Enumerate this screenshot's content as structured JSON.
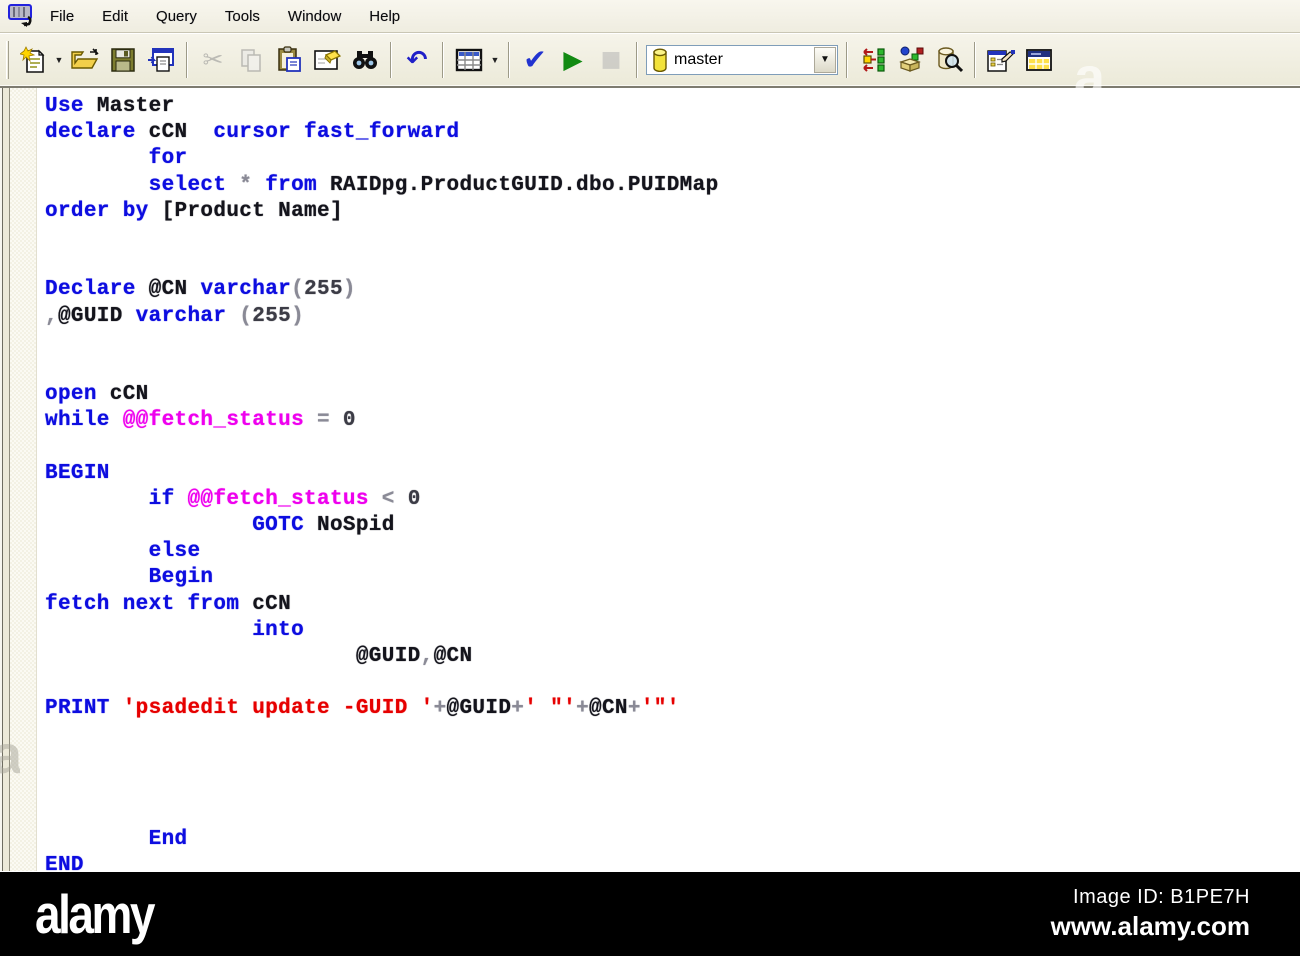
{
  "menubar": {
    "items": [
      "File",
      "Edit",
      "Query",
      "Tools",
      "Window",
      "Help"
    ]
  },
  "toolbar": {
    "icons": [
      "new-query-icon",
      "open-icon",
      "save-icon",
      "insert-template-icon",
      "cut-icon",
      "copy-icon",
      "paste-icon",
      "clear-window-icon",
      "find-icon",
      "undo-icon",
      "execute-mode-grid-icon",
      "parse-query-icon",
      "execute-query-icon",
      "cancel-query-icon",
      "database-cylinder-icon",
      "execution-plan-icon",
      "object-browser-icon",
      "object-search-icon",
      "connection-properties-icon",
      "results-pane-icon"
    ],
    "database_combo": {
      "value": "master"
    },
    "glyphs": {
      "cut": "✂",
      "undo": "↶",
      "parse": "✔",
      "execute": "▶",
      "stop": "■",
      "caret": "▼"
    }
  },
  "editor": {
    "language": "sql",
    "lines": [
      [
        [
          "kw",
          "Use "
        ],
        [
          "id",
          "Master"
        ]
      ],
      [
        [
          "kw",
          "declare "
        ],
        [
          "id",
          "cCN  "
        ],
        [
          "kw",
          "cursor fast_forward"
        ]
      ],
      [
        [
          "id",
          "        "
        ],
        [
          "kw",
          "for"
        ]
      ],
      [
        [
          "id",
          "        "
        ],
        [
          "kw",
          "select "
        ],
        [
          "op",
          "* "
        ],
        [
          "kw",
          "from "
        ],
        [
          "id",
          "RAIDpg.ProductGUID.dbo.PUIDMap"
        ]
      ],
      [
        [
          "kw",
          "order by "
        ],
        [
          "id",
          "[Product Name]"
        ]
      ],
      [],
      [],
      [
        [
          "kw",
          "Declare "
        ],
        [
          "id",
          "@CN "
        ],
        [
          "kw",
          "varchar"
        ],
        [
          "op",
          "("
        ],
        [
          "num",
          "255"
        ],
        [
          "op",
          ")"
        ]
      ],
      [
        [
          "op",
          ","
        ],
        [
          "id",
          "@GUID "
        ],
        [
          "kw",
          "varchar "
        ],
        [
          "op",
          "("
        ],
        [
          "num",
          "255"
        ],
        [
          "op",
          ")"
        ]
      ],
      [],
      [],
      [
        [
          "kw",
          "open "
        ],
        [
          "id",
          "cCN"
        ]
      ],
      [
        [
          "kw",
          "while "
        ],
        [
          "sys",
          "@@fetch_status"
        ],
        [
          "op",
          " = "
        ],
        [
          "num",
          "0"
        ]
      ],
      [],
      [
        [
          "kw",
          "BEGIN"
        ]
      ],
      [
        [
          "id",
          "        "
        ],
        [
          "kw",
          "if "
        ],
        [
          "sys",
          "@@fetch_status"
        ],
        [
          "op",
          " < "
        ],
        [
          "num",
          "0"
        ]
      ],
      [
        [
          "id",
          "                "
        ],
        [
          "kw",
          "GOTC "
        ],
        [
          "id",
          "NoSpid"
        ]
      ],
      [
        [
          "id",
          "        "
        ],
        [
          "kw",
          "else"
        ]
      ],
      [
        [
          "id",
          "        "
        ],
        [
          "kw",
          "Begin"
        ]
      ],
      [
        [
          "kw",
          "fetch next from "
        ],
        [
          "id",
          "cCN"
        ]
      ],
      [
        [
          "id",
          "                "
        ],
        [
          "kw",
          "into"
        ]
      ],
      [
        [
          "id",
          "                        "
        ],
        [
          "id",
          "@GUID"
        ],
        [
          "op",
          ","
        ],
        [
          "id",
          "@CN"
        ]
      ],
      [],
      [
        [
          "kw",
          "PRINT "
        ],
        [
          "str",
          "'psadedit update -GUID '"
        ],
        [
          "op",
          "+"
        ],
        [
          "id",
          "@GUID"
        ],
        [
          "op",
          "+"
        ],
        [
          "str",
          "' \"'"
        ],
        [
          "op",
          "+"
        ],
        [
          "id",
          "@CN"
        ],
        [
          "op",
          "+"
        ],
        [
          "str",
          "'\"'"
        ]
      ],
      [],
      [],
      [],
      [],
      [
        [
          "id",
          "        "
        ],
        [
          "kw",
          "End"
        ]
      ],
      [
        [
          "kw",
          "END"
        ]
      ]
    ]
  },
  "footer": {
    "logo": "alamy",
    "image_id_label": "Image ID: B1PE7H",
    "url": "www.alamy.com"
  },
  "colors": {
    "keyword": "#0d0de0",
    "identifier": "#14141c",
    "system_function": "#ee00ee",
    "operator": "#8a8a96",
    "string": "#e60000",
    "number": "#3c3c46",
    "toolbar_bg": "#f0eee0",
    "editor_bg": "#ffffff",
    "footer_bg": "#000000"
  }
}
